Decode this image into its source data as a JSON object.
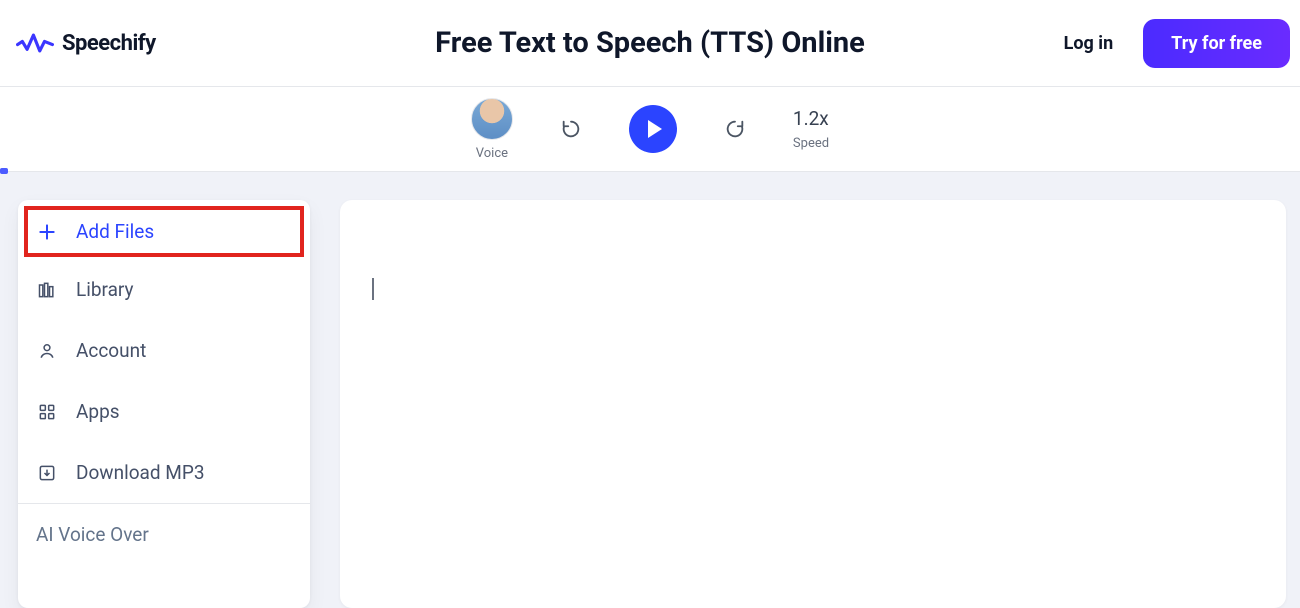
{
  "brand": {
    "name": "Speechify"
  },
  "page": {
    "title": "Free Text to Speech (TTS) Online"
  },
  "header": {
    "login_label": "Log in",
    "cta_label": "Try for free"
  },
  "toolbar": {
    "voice_label": "Voice",
    "speed_value": "1.2x",
    "speed_label": "Speed"
  },
  "sidebar": {
    "items": [
      {
        "key": "add-files",
        "label": "Add Files"
      },
      {
        "key": "library",
        "label": "Library"
      },
      {
        "key": "account",
        "label": "Account"
      },
      {
        "key": "apps",
        "label": "Apps"
      },
      {
        "key": "download-mp3",
        "label": "Download MP3"
      },
      {
        "key": "ai-voice-over",
        "label": "AI Voice Over"
      }
    ]
  }
}
